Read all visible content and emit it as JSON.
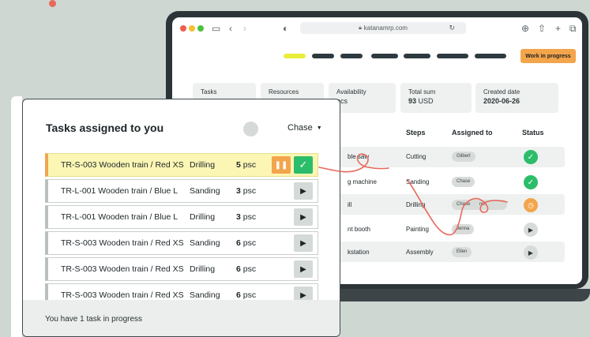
{
  "browser": {
    "url": "katanamrp.com"
  },
  "background_app": {
    "work_in_progress_label": "Work in progress",
    "summary": [
      {
        "label": "Tasks",
        "value": "",
        "unit": ""
      },
      {
        "label": "Resources",
        "value": "",
        "unit": ""
      },
      {
        "label": "Availability",
        "value": "pcs",
        "unit": ""
      },
      {
        "label": "Total sum",
        "value": "93",
        "unit": "USD"
      },
      {
        "label": "Created date",
        "value": "2020-06-26",
        "unit": ""
      }
    ],
    "columns": {
      "steps": "Steps",
      "assigned_to": "Assigned to",
      "status": "Status"
    },
    "rows": [
      {
        "resource": "ble saw",
        "step": "Cutting",
        "assignee": "Gilbert",
        "status": "done"
      },
      {
        "resource": "g machine",
        "step": "Sanding",
        "assignee": "Chase",
        "status": "done"
      },
      {
        "resource": "ill",
        "step": "Drilling",
        "assignee": "Chase",
        "assignee2": "ren",
        "status": "in-progress"
      },
      {
        "resource": "nt booth",
        "step": "Painting",
        "assignee": "Jenna",
        "status": "not-started"
      },
      {
        "resource": "kstation",
        "step": "Assembly",
        "assignee": "Ellen",
        "status": "not-started"
      }
    ]
  },
  "panel": {
    "title": "Tasks assigned to you",
    "user": "Chase",
    "tasks": [
      {
        "name": "TR-S-003 Wooden train / Red XS",
        "step": "Drilling",
        "qty": "5",
        "unit": "psc",
        "active": true
      },
      {
        "name": "TR-L-001 Wooden train / Blue L",
        "step": "Sanding",
        "qty": "3",
        "unit": "psc",
        "active": false
      },
      {
        "name": "TR-L-001 Wooden train / Blue L",
        "step": "Drilling",
        "qty": "3",
        "unit": "psc",
        "active": false
      },
      {
        "name": "TR-S-003 Wooden train / Red XS",
        "step": "Sanding",
        "qty": "6",
        "unit": "psc",
        "active": false
      },
      {
        "name": "TR-S-003 Wooden train / Red XS",
        "step": "Drilling",
        "qty": "6",
        "unit": "psc",
        "active": false
      },
      {
        "name": "TR-S-003 Wooden train / Red XS",
        "step": "Sanding",
        "qty": "6",
        "unit": "psc",
        "active": false
      }
    ],
    "footer_text": "You have 1 task in progress"
  },
  "colors": {
    "accent_orange": "#f3a54c",
    "success_green": "#2bbd6a",
    "highlight_yellow": "#fbf6b4",
    "annotation_red": "#e8685a"
  }
}
